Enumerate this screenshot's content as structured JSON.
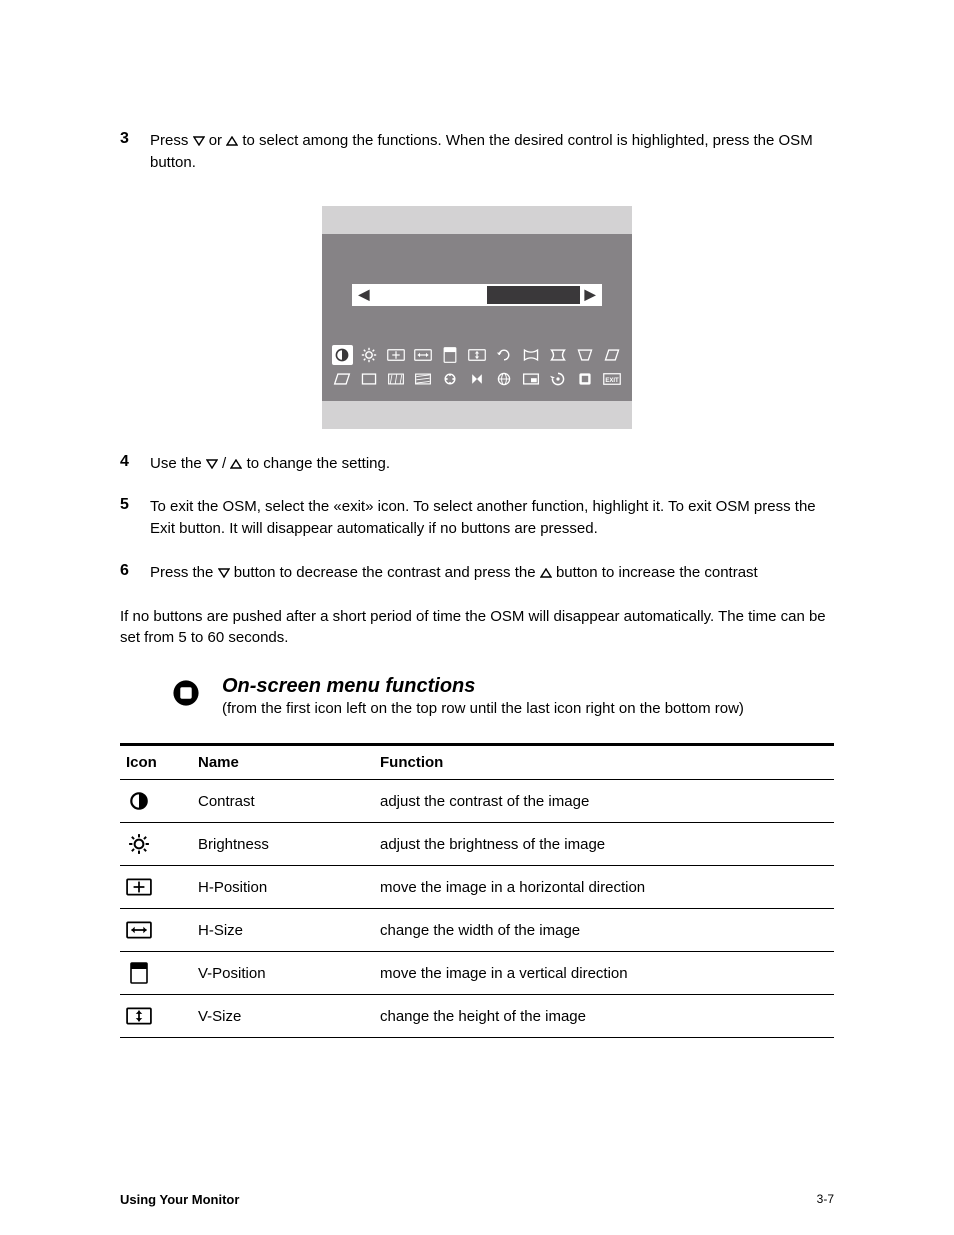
{
  "steps": {
    "s3_a": "Press",
    "s3_b": "or",
    "s3_c": "to select among the functions. When the desired control is highlighted, press the OSM button.",
    "s4_a": "Use the",
    "s4_b": "to change the setting.",
    "s5": "To exit the OSM, select the «exit» icon. To select another function, highlight it. To exit OSM press the Exit button. It will disappear automatically if no buttons are pressed.",
    "s6_a": "Press the",
    "s6_b": "button to decrease the contrast and press the",
    "s6_c": "button to increase the contrast"
  },
  "post_step": "If no buttons are pushed after a short period of time the OSM will disappear automatically. The time can be set from 5 to 60 seconds.",
  "slab": {
    "heading": "On-screen menu functions",
    "sub": "(from the first icon left on the top row until the last icon right on the bottom row)"
  },
  "table": {
    "headers": {
      "icon": "Icon",
      "name": "Name",
      "function": "Function"
    },
    "rows": [
      {
        "name": "Contrast",
        "function": "adjust the contrast of the image"
      },
      {
        "name": "Brightness",
        "function": "adjust the brightness of the image"
      },
      {
        "name": "H-Position",
        "function": "move the image in a horizontal direction"
      },
      {
        "name": "H-Size",
        "function": "change the width of the image"
      },
      {
        "name": "V-Position",
        "function": "move the image in a vertical direction"
      },
      {
        "name": "V-Size",
        "function": "change the height of the image"
      }
    ]
  },
  "osd_icons_row1": [
    "contrast",
    "brightness",
    "h-position",
    "h-size",
    "v-position",
    "v-size",
    "rotation",
    "pincushion-1",
    "pincushion-2",
    "trapezoid-1",
    "trapezoid-2"
  ],
  "osd_icons_row2": [
    "parallelogram",
    "square",
    "moire-h",
    "moire-v",
    "color",
    "degauss",
    "language",
    "osd-position",
    "recall",
    "status",
    "exit"
  ],
  "footer": {
    "title": "Using Your Monitor",
    "page": "3-7"
  }
}
